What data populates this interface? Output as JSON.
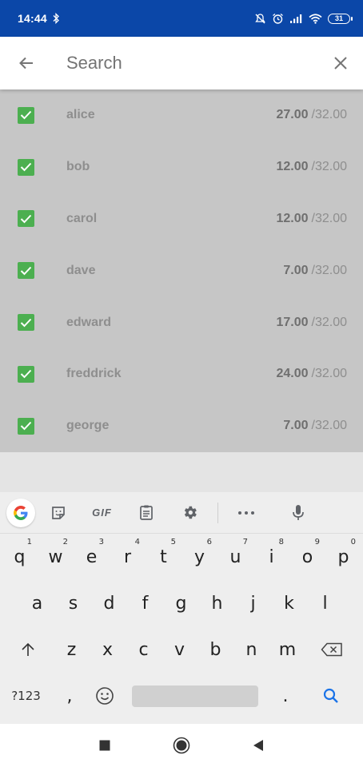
{
  "status_bar": {
    "time": "14:44",
    "battery": "31",
    "icons": [
      "bluetooth-icon",
      "mute-icon",
      "alarm-icon",
      "signal-icon",
      "wifi-icon",
      "battery-icon"
    ]
  },
  "app_bar": {
    "search_placeholder": "Search",
    "back_icon": "back-arrow-icon",
    "close_icon": "close-icon"
  },
  "list": {
    "items": [
      {
        "name": "alice",
        "amount": "27.00",
        "total": "/32.00",
        "checked": true
      },
      {
        "name": "bob",
        "amount": "12.00",
        "total": "/32.00",
        "checked": true
      },
      {
        "name": "carol",
        "amount": "12.00",
        "total": "/32.00",
        "checked": true
      },
      {
        "name": "dave",
        "amount": "7.00",
        "total": "/32.00",
        "checked": true
      },
      {
        "name": "edward",
        "amount": "17.00",
        "total": "/32.00",
        "checked": true
      },
      {
        "name": "freddrick",
        "amount": "24.00",
        "total": "/32.00",
        "checked": true
      },
      {
        "name": "george",
        "amount": "7.00",
        "total": "/32.00",
        "checked": true
      }
    ]
  },
  "keyboard": {
    "toolbar": {
      "gif_label": "GIF"
    },
    "row1": [
      {
        "key": "q",
        "hint": "1"
      },
      {
        "key": "w",
        "hint": "2"
      },
      {
        "key": "e",
        "hint": "3"
      },
      {
        "key": "r",
        "hint": "4"
      },
      {
        "key": "t",
        "hint": "5"
      },
      {
        "key": "y",
        "hint": "6"
      },
      {
        "key": "u",
        "hint": "7"
      },
      {
        "key": "i",
        "hint": "8"
      },
      {
        "key": "o",
        "hint": "9"
      },
      {
        "key": "p",
        "hint": "0"
      }
    ],
    "row2": [
      "a",
      "s",
      "d",
      "f",
      "g",
      "h",
      "j",
      "k",
      "l"
    ],
    "row3": [
      "z",
      "x",
      "c",
      "v",
      "b",
      "n",
      "m"
    ],
    "row4": {
      "symbols": "?123",
      "comma": ",",
      "period": "."
    }
  },
  "nav_bar": {
    "icons": [
      "recents-icon",
      "home-icon",
      "back-icon"
    ]
  },
  "colors": {
    "status_bar": "#0b47a8",
    "checkbox": "#4caf50",
    "search_key": "#1a73e8"
  }
}
